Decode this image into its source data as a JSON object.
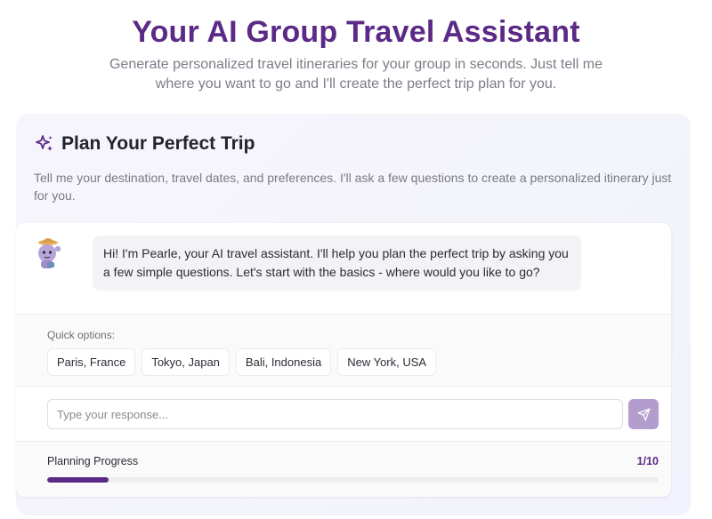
{
  "header": {
    "title": "Your AI Group Travel Assistant",
    "subtitle": "Generate personalized travel itineraries for your group in seconds. Just tell me where you want to go and I'll create the perfect trip plan for you."
  },
  "card": {
    "icon": "sparkle-icon",
    "title": "Plan Your Perfect Trip",
    "description": "Tell me your destination, travel dates, and preferences. I'll ask a few questions to create a personalized itinerary just for you."
  },
  "chat": {
    "messages": [
      {
        "sender": "assistant",
        "avatar": "avatar-icon",
        "text": "Hi! I'm Pearle, your AI travel assistant. I'll help you plan the perfect trip by asking you a few simple questions. Let's start with the basics - where would you like to go?"
      }
    ],
    "quick_options_label": "Quick options:",
    "quick_options": [
      "Paris, France",
      "Tokyo, Japan",
      "Bali, Indonesia",
      "New York, USA"
    ],
    "input": {
      "placeholder": "Type your response...",
      "value": ""
    },
    "send_icon": "send-icon"
  },
  "progress": {
    "label": "Planning Progress",
    "count_text": "1/10",
    "current": 1,
    "total": 10
  },
  "colors": {
    "brand": "#5b2a86",
    "send_button": "#b39dcc",
    "card_bg": "#f5f4fb"
  }
}
